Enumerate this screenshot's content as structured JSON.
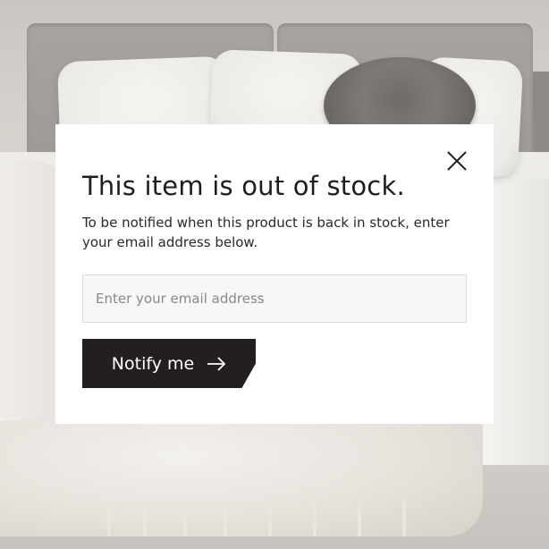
{
  "modal": {
    "title": "This item is out of stock.",
    "description": "To be notified when this product is back in stock, enter your email address below.",
    "email_input": {
      "placeholder": "Enter your email address",
      "value": ""
    },
    "notify_button": {
      "label": "Notify me",
      "icon": "arrow-right-icon"
    },
    "close_icon": "close-icon"
  },
  "colors": {
    "modal_background": "#ffffff",
    "button_background": "#231f20",
    "button_text": "#ffffff",
    "title_text": "#1f1d1d",
    "input_background": "#f7f7f7",
    "input_border": "#dcdcdc"
  }
}
